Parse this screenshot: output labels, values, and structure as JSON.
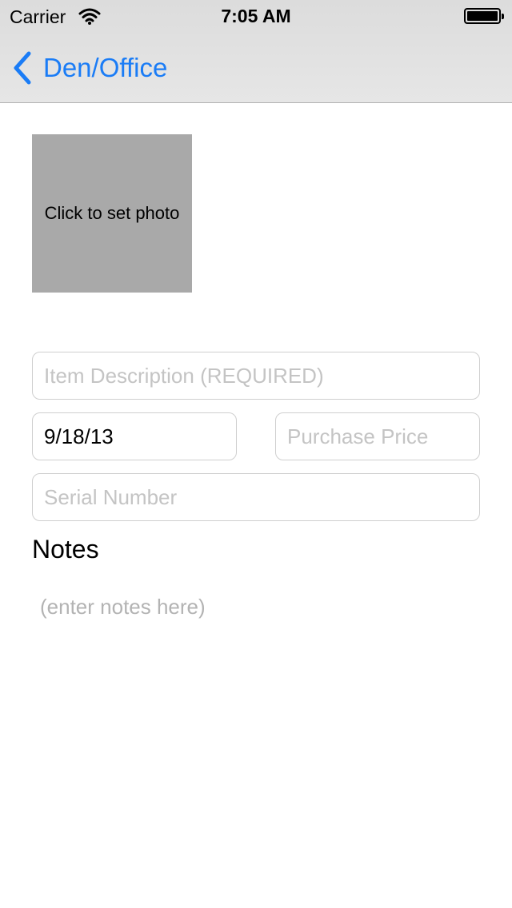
{
  "status_bar": {
    "carrier": "Carrier",
    "time": "7:05 AM",
    "icons": {
      "wifi": "wifi-icon",
      "battery": "battery-icon"
    }
  },
  "nav_bar": {
    "back_label": "Den/Office",
    "back_icon": "chevron-left-icon",
    "tint_color": "#1a7cf6",
    "background_color": "#dfdfdf"
  },
  "photo": {
    "label": "Click to set photo",
    "background_color": "#a9a9a9"
  },
  "form": {
    "description": {
      "value": "",
      "placeholder": "Item Description (REQUIRED)"
    },
    "purchase_date": {
      "value": "9/18/13",
      "placeholder": ""
    },
    "purchase_price": {
      "value": "",
      "placeholder": "Purchase Price"
    },
    "serial_number": {
      "value": "",
      "placeholder": "Serial Number"
    }
  },
  "notes": {
    "heading": "Notes",
    "value": "",
    "placeholder": "(enter notes here)"
  }
}
